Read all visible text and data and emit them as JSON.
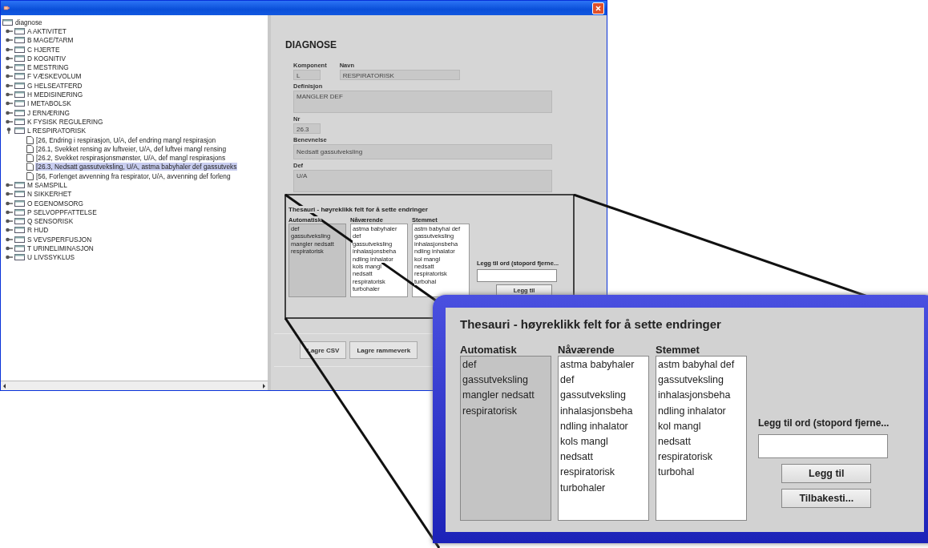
{
  "tree": {
    "label": "diagnose",
    "children": [
      {
        "label": "A AKTIVITET",
        "expanded": false,
        "selected": false
      },
      {
        "label": "B MAGE/TARM",
        "expanded": false,
        "selected": false
      },
      {
        "label": "C HJERTE",
        "expanded": false,
        "selected": false
      },
      {
        "label": "D KOGNITIV",
        "expanded": false,
        "selected": false
      },
      {
        "label": "E MESTRING",
        "expanded": false,
        "selected": false
      },
      {
        "label": "F VÆSKEVOLUM",
        "expanded": false,
        "selected": false
      },
      {
        "label": "G HELSEATFERD",
        "expanded": false,
        "selected": false
      },
      {
        "label": "H MEDISINERING",
        "expanded": false,
        "selected": false
      },
      {
        "label": "I METABOLSK",
        "expanded": false,
        "selected": false
      },
      {
        "label": "J ERNÆRING",
        "expanded": false,
        "selected": false
      },
      {
        "label": "K FYSISK REGULERING",
        "expanded": false,
        "selected": false
      },
      {
        "label": "L RESPIRATORISK",
        "expanded": true,
        "selected": false,
        "children": [
          {
            "label": "[26, Endring i respirasjon, U/A, def endring mangl respirasjon",
            "selected": false
          },
          {
            "label": "[26.1, Svekket rensing av luftveier, U/A, def luftvei mangl rensing",
            "selected": false
          },
          {
            "label": "[26.2, Svekket respirasjonsmønster, U/A, def mangl respirasjons",
            "selected": false
          },
          {
            "label": "[26.3, Nedsatt gassutveksling, U/A, astma babyhaler def gassutveks",
            "selected": true
          },
          {
            "label": "[56, Forlenget avvenning fra respirator, U/A, avvenning def forleng",
            "selected": false
          }
        ]
      },
      {
        "label": "M SAMSPILL",
        "expanded": false,
        "selected": false
      },
      {
        "label": "N SIKKERHET",
        "expanded": false,
        "selected": false
      },
      {
        "label": "O EGENOMSORG",
        "expanded": false,
        "selected": false
      },
      {
        "label": "P SELVOPPFATTELSE",
        "expanded": false,
        "selected": false
      },
      {
        "label": "Q SENSORISK",
        "expanded": false,
        "selected": false
      },
      {
        "label": "R HUD",
        "expanded": false,
        "selected": false
      },
      {
        "label": "S VEVSPERFUSJON",
        "expanded": false,
        "selected": false
      },
      {
        "label": "T URINELIMINASJON",
        "expanded": false,
        "selected": false
      },
      {
        "label": "U LIVSSYKLUS",
        "expanded": false,
        "selected": false
      }
    ]
  },
  "form": {
    "title": "DIAGNOSE",
    "rows": [
      [
        {
          "label": "Komponent",
          "value": "L",
          "kind": "short"
        },
        {
          "label": "Navn",
          "value": "RESPIRATORISK",
          "kind": "medium"
        }
      ],
      [
        {
          "label": "Definisjon",
          "value": "MANGLER DEF",
          "kind": "area"
        }
      ],
      [
        {
          "label": "Nr",
          "value": "26.3",
          "kind": "short"
        }
      ],
      [
        {
          "label": "Benevnelse",
          "value": "Nedsatt gassutveksling",
          "kind": "line"
        }
      ],
      [
        {
          "label": "Def",
          "value": "U/A",
          "kind": "area"
        }
      ]
    ]
  },
  "thesauri": {
    "title": "Thesauri - høyreklikk felt for å sette endringer",
    "columns": [
      {
        "header": "Automatisk",
        "kind": "readonly",
        "items": [
          "def",
          "gassutveksling",
          "mangler nedsatt",
          "respiratorisk"
        ]
      },
      {
        "header": "Nåværende",
        "kind": "editable",
        "items": [
          "astma babyhaler",
          "def",
          "gassutveksling",
          "inhalasjonsbeha",
          "ndling inhalator",
          "kols mangl",
          "nedsatt",
          "respiratorisk",
          "turbohaler"
        ]
      },
      {
        "header": "Stemmet",
        "kind": "editable",
        "items": [
          "astm babyhal def",
          "gassutveksling",
          "inhalasjonsbeha",
          "ndling inhalator",
          "kol mangl",
          "nedsatt",
          "respiratorisk",
          "turbohal"
        ]
      }
    ],
    "add_label": "Legg til ord (stopord fjerne...",
    "buttons": [
      "Legg til"
    ]
  },
  "bottom_buttons": [
    "Lagre CSV",
    "Lagre rammeverk"
  ],
  "inset": {
    "title": "Thesauri - høyreklikk felt for å sette endringer",
    "columns": [
      {
        "header": "Automatisk",
        "kind": "readonly",
        "items": [
          "def",
          "gassutveksling",
          "mangler nedsatt",
          "respiratorisk"
        ]
      },
      {
        "header": "Nåværende",
        "kind": "editable",
        "items": [
          "astma babyhaler",
          "def",
          "gassutveksling",
          "inhalasjonsbeha",
          "ndling inhalator",
          "kols mangl",
          "nedsatt",
          "respiratorisk",
          "turbohaler"
        ]
      },
      {
        "header": "Stemmet",
        "kind": "editable",
        "items": [
          "astm babyhal def",
          "gassutveksling",
          "inhalasjonsbeha",
          "ndling inhalator",
          "kol mangl",
          "nedsatt",
          "respiratorisk",
          "turbohal"
        ]
      }
    ],
    "add_label": "Legg til ord (stopord fjerne...",
    "buttons": [
      "Legg til",
      "Tilbakesti..."
    ]
  }
}
